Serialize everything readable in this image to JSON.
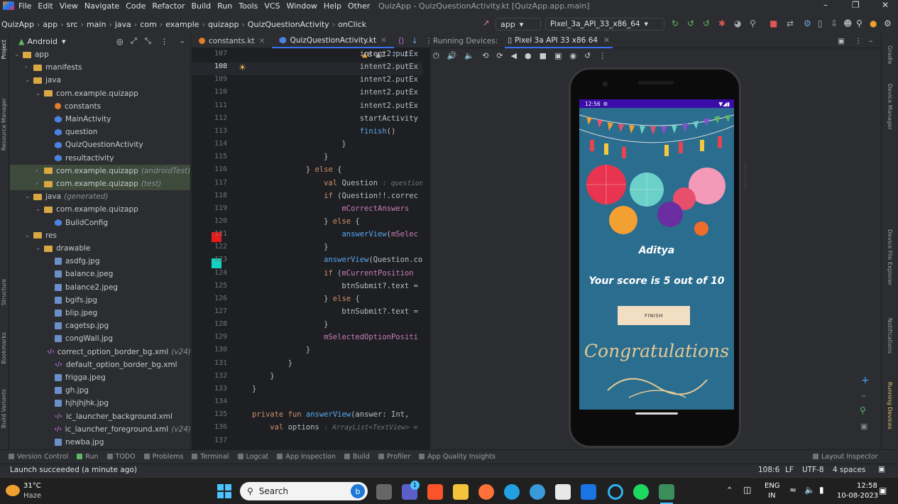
{
  "menu": [
    "File",
    "Edit",
    "View",
    "Navigate",
    "Code",
    "Refactor",
    "Build",
    "Run",
    "Tools",
    "VCS",
    "Window",
    "Help",
    "Other"
  ],
  "window_title": "QuizApp - QuizQuestionActivity.kt [QuizApp.app.main]",
  "breadcrumbs": [
    "QuizApp",
    "app",
    "src",
    "main",
    "java",
    "com",
    "example",
    "quizapp",
    "QuizQuestionActivity",
    "onClick"
  ],
  "toolbar": {
    "run_config": "app",
    "device": "Pixel_3a_API_33_x86_64"
  },
  "project": {
    "view": "Android",
    "tree": [
      {
        "label": "app",
        "indent": 0,
        "kind": "folder",
        "chev": "v"
      },
      {
        "label": "manifests",
        "indent": 1,
        "kind": "folder",
        "chev": ">"
      },
      {
        "label": "java",
        "indent": 1,
        "kind": "folder",
        "chev": "v"
      },
      {
        "label": "com.example.quizapp",
        "indent": 2,
        "kind": "folder",
        "chev": "v"
      },
      {
        "label": "constants",
        "indent": 3,
        "kind": "ktfile"
      },
      {
        "label": "MainActivity",
        "indent": 3,
        "kind": "kt"
      },
      {
        "label": "question",
        "indent": 3,
        "kind": "kt"
      },
      {
        "label": "QuizQuestionActivity",
        "indent": 3,
        "kind": "kt"
      },
      {
        "label": "resultactivity",
        "indent": 3,
        "kind": "kt"
      },
      {
        "label": "com.example.quizapp",
        "suffix": "(androidTest)",
        "indent": 2,
        "kind": "folder",
        "chev": ">",
        "hl": true
      },
      {
        "label": "com.example.quizapp",
        "suffix": "(test)",
        "indent": 2,
        "kind": "folder",
        "chev": ">",
        "hl": true
      },
      {
        "label": "java",
        "suffix": "(generated)",
        "indent": 1,
        "kind": "folder",
        "chev": "v"
      },
      {
        "label": "com.example.quizapp",
        "indent": 2,
        "kind": "folder",
        "chev": "v"
      },
      {
        "label": "BuildConfig",
        "indent": 3,
        "kind": "kt"
      },
      {
        "label": "res",
        "indent": 1,
        "kind": "folder",
        "chev": "v"
      },
      {
        "label": "drawable",
        "indent": 2,
        "kind": "folder",
        "chev": "v"
      },
      {
        "label": "asdfg.jpg",
        "indent": 3,
        "kind": "img"
      },
      {
        "label": "balance.jpeg",
        "indent": 3,
        "kind": "img"
      },
      {
        "label": "balance2.jpeg",
        "indent": 3,
        "kind": "img"
      },
      {
        "label": "bgifs.jpg",
        "indent": 3,
        "kind": "img"
      },
      {
        "label": "blip.jpeg",
        "indent": 3,
        "kind": "img"
      },
      {
        "label": "cagetsp.jpg",
        "indent": 3,
        "kind": "img"
      },
      {
        "label": "congWall.jpg",
        "indent": 3,
        "kind": "img"
      },
      {
        "label": "correct_option_border_bg.xml",
        "suffix": "(v24)",
        "indent": 3,
        "kind": "xml"
      },
      {
        "label": "default_option_border_bg.xml",
        "indent": 3,
        "kind": "xml"
      },
      {
        "label": "frigga.jpeg",
        "indent": 3,
        "kind": "img"
      },
      {
        "label": "gh.jpg",
        "indent": 3,
        "kind": "img"
      },
      {
        "label": "hjhjhjhk.jpg",
        "indent": 3,
        "kind": "img"
      },
      {
        "label": "ic_launcher_background.xml",
        "indent": 3,
        "kind": "xml"
      },
      {
        "label": "ic_launcher_foreground.xml",
        "suffix": "(v24)",
        "indent": 3,
        "kind": "xml"
      },
      {
        "label": "newba.jpg",
        "indent": 3,
        "kind": "img"
      }
    ]
  },
  "editor": {
    "tabs": [
      "constants.kt",
      "QuizQuestionActivity.kt"
    ],
    "warnings": "8",
    "weak": "2",
    "lines": [
      {
        "n": "107",
        "t": "                        intent2.putEx"
      },
      {
        "n": "108",
        "t": "                        intent2.putEx"
      },
      {
        "n": "109",
        "t": "                        intent2.putEx"
      },
      {
        "n": "110",
        "t": "                        intent2.putEx"
      },
      {
        "n": "111",
        "t": "                        intent2.putEx"
      },
      {
        "n": "112",
        "t": "                        startActivity"
      },
      {
        "n": "113",
        "t": "                        finish()"
      },
      {
        "n": "114",
        "t": "                    }"
      },
      {
        "n": "115",
        "t": "                }"
      },
      {
        "n": "116",
        "t": "            } else {"
      },
      {
        "n": "117",
        "t": "                val Question",
        "hint": ": question?"
      },
      {
        "n": "118",
        "t": "                if (Question!!.correc"
      },
      {
        "n": "119",
        "t": "                    mCorrectAnswers"
      },
      {
        "n": "120",
        "t": "                } else {"
      },
      {
        "n": "121",
        "t": "                    answerView(mSelec"
      },
      {
        "n": "122",
        "t": "                }"
      },
      {
        "n": "123",
        "t": "                answerView(Question.co"
      },
      {
        "n": "124",
        "t": "                if (mCurrentPosition"
      },
      {
        "n": "125",
        "t": "                    btnSubmit?.text ="
      },
      {
        "n": "126",
        "t": "                } else {"
      },
      {
        "n": "127",
        "t": "                    btnSubmit?.text ="
      },
      {
        "n": "128",
        "t": "                }"
      },
      {
        "n": "129",
        "t": "                mSelectedOptionPositi"
      },
      {
        "n": "130",
        "t": "            }"
      },
      {
        "n": "131",
        "t": "        }"
      },
      {
        "n": "132",
        "t": "    }"
      },
      {
        "n": "133",
        "t": "}"
      },
      {
        "n": "134",
        "t": ""
      },
      {
        "n": "135",
        "t": "private fun answerView(answer: Int,"
      },
      {
        "n": "136",
        "t": "    val options",
        "hint": ": ArrayList<TextView> ="
      },
      {
        "n": "137",
        "t": ""
      }
    ]
  },
  "running_devices": {
    "label": "Running Devices:",
    "tab": "Pixel 3a API 33 x86 64"
  },
  "phone": {
    "time": "12:56",
    "name": "Aditya",
    "score": "Your score is 5 out of 10",
    "button": "FINISH",
    "congrats": "Congratulations"
  },
  "right_tools": [
    "Gradle",
    "Device Manager",
    "Device File Explorer",
    "Notifications",
    "Running Devices"
  ],
  "left_tools": [
    "Project",
    "Resource Manager",
    "Structure",
    "Bookmarks",
    "Build Variants"
  ],
  "bottom_tools": [
    "Version Control",
    "Run",
    "TODO",
    "Problems",
    "Terminal",
    "Logcat",
    "App Inspection",
    "Build",
    "Profiler",
    "App Quality Insights",
    "Layout Inspector"
  ],
  "status": {
    "message": "Launch succeeded (a minute ago)",
    "position": "108:6",
    "line_sep": "LF",
    "encoding": "UTF-8",
    "indent": "4 spaces"
  },
  "taskbar": {
    "weather_temp": "31°C",
    "weather_desc": "Haze",
    "search": "Search",
    "lang1": "ENG",
    "lang2": "IN",
    "time": "12:58",
    "date": "10-08-2023",
    "badge": "1"
  }
}
